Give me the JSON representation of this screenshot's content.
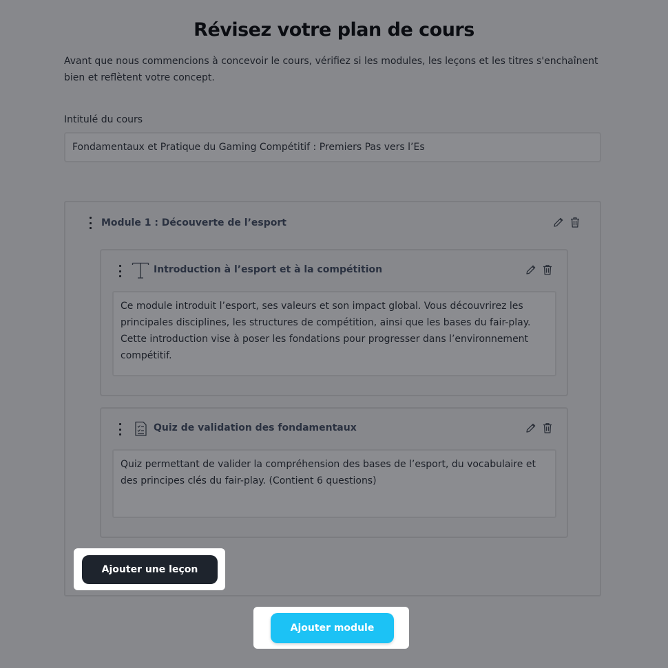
{
  "page": {
    "title": "Révisez votre plan de cours",
    "subtitle": "Avant que nous commencions à concevoir le cours, vérifiez si les modules, les leçons et les titres s'enchaînent bien et reflètent votre concept."
  },
  "course": {
    "title_label": "Intitulé du cours",
    "title_value": "Fondamentaux et Pratique du Gaming Compétitif : Premiers Pas vers l’Es"
  },
  "module": {
    "title": "Module 1 : Découverte de l’esport",
    "lessons": [
      {
        "type_icon": "text-icon",
        "title": "Introduction à l’esport et à la compétition",
        "description": "Ce module introduit l’esport, ses valeurs et son impact global. Vous découvrirez les principales disciplines, les structures de compétition, ainsi que les bases du fair-play. Cette introduction vise à poser les fondations pour progresser dans l’environnement compétitif."
      },
      {
        "type_icon": "quiz-icon",
        "title": "Quiz de validation des fondamentaux",
        "description": "Quiz permettant de valider la compréhension des bases de l’esport, du vocabulaire et des principes clés du fair-play. (Contient 6 questions)"
      }
    ],
    "add_lesson_label": "Ajouter une leçon"
  },
  "actions": {
    "add_module_label": "Ajouter module"
  },
  "colors": {
    "overlay_background": "#87888c",
    "primary_dark": "#1e242d",
    "accent_blue": "#1cc2f5"
  }
}
